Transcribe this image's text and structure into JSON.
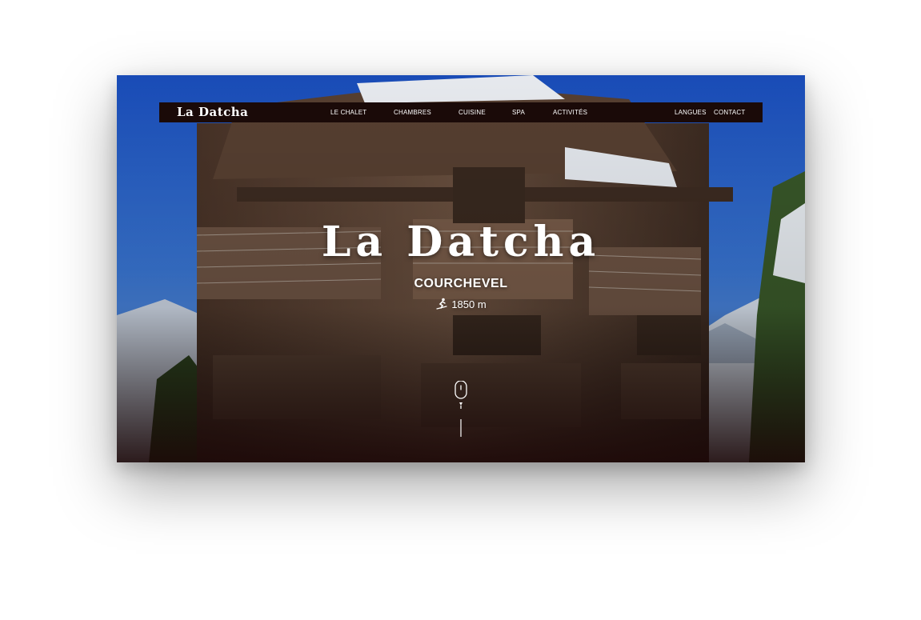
{
  "site": {
    "logo": "La Datcha",
    "nav_left": [
      "LE CHALET",
      "CHAMBRES",
      "CUISINE",
      "SPA",
      "ACTIVITÉS"
    ],
    "nav_right": [
      "LANGUES",
      "CONTACT"
    ]
  },
  "hero": {
    "title": "La Datcha",
    "subtitle": "COURCHEVEL",
    "altitude": "1850 m",
    "altitude_icon": "skier-icon",
    "scroll_icon": "mouse-scroll-icon"
  },
  "colors": {
    "navbar_bg": "#1a0a08",
    "text": "#ffffff",
    "sky": "#1f5fc9",
    "wood": "#5a4233"
  }
}
